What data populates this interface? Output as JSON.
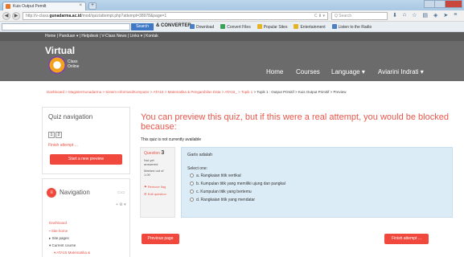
{
  "browser": {
    "tab_title": "Kuis Output Pemilt",
    "tab_close": "×",
    "new_tab": "+",
    "url_prefix": "http://v-class.",
    "url_domain": "gunadarma.ac.id",
    "url_path": "/mod/quiz/attempt.php?attempt=38978&page=1",
    "url_controls": "C  ⬇ ▾",
    "search_placeholder": "Q Search",
    "toolbar_search_button": "Search",
    "converter_label": "& CONVERTER",
    "toolbar_items": [
      {
        "label": "Download",
        "color": "#4a7fc1"
      },
      {
        "label": "Convert Files",
        "color": "#3aa05a"
      },
      {
        "label": "Popular Sites",
        "color": "#e6b422"
      },
      {
        "label": "Entertainment",
        "color": "#e6b422"
      },
      {
        "label": "Listen to the Radio",
        "color": "#4a7fc1"
      }
    ]
  },
  "site": {
    "top_menu": "Home | Panduan ▾ | Helpdesk | V-Class News | Links ▾ | Kontak",
    "logo_word": "Virtual",
    "logo_sub_1": "Class",
    "logo_sub_2": "Online",
    "nav_home": "Home",
    "nav_courses": "Courses",
    "nav_language": "Language ▾",
    "nav_user": "Aviarini Indrati ▾"
  },
  "breadcrumb": {
    "links": "Dashboard > MagisterGunadarma > Sistem Informasi/Komputer > ATA15 > Matematika & Pengambilan Data > ATA15_ > Topik 1",
    "current": " > Topik 1 : Output Primitif > Kuis Output Primitif > Preview"
  },
  "quiz_nav": {
    "title": "Quiz navigation",
    "q1": "1",
    "q2": "2",
    "finish_link": "Finish attempt ...",
    "start_button": "Start a new preview"
  },
  "navigation": {
    "icon": "≡",
    "title": "Navigation",
    "ctl_dock": "▭▭",
    "ctl_move": "+ ⚙ ▾",
    "items": [
      {
        "label": "Dashboard",
        "link": true
      },
      {
        "label": "Site home",
        "link": true
      },
      {
        "label": "Site pages",
        "link": false
      },
      {
        "label": "Current course",
        "link": false
      },
      {
        "label": "ATA15 Matematika &",
        "link": true
      }
    ]
  },
  "main": {
    "warning": "You can preview this quiz, but if this were a real attempt, you would be blocked because:",
    "not_available": "This quiz is not currently available",
    "question_label": "Question",
    "question_number": "3",
    "status_1": "Not yet",
    "status_2": "answered",
    "marked_1": "Marked out of",
    "marked_2": "1.00",
    "flag_label": "Remove flag",
    "edit_label": "Edit question",
    "question_text": "Garis adalah",
    "select_one": "Select one:",
    "options": [
      "a. Rangkaian titik vertikal",
      "b. Kumpulan titik yang memiliki ujung dan pangkal",
      "c. Kumpulan titik yang bertemu",
      "d. Rangkaian titik yang mendatar"
    ],
    "prev_button": "Previous page",
    "finish_button": "Finish attempt ..."
  }
}
